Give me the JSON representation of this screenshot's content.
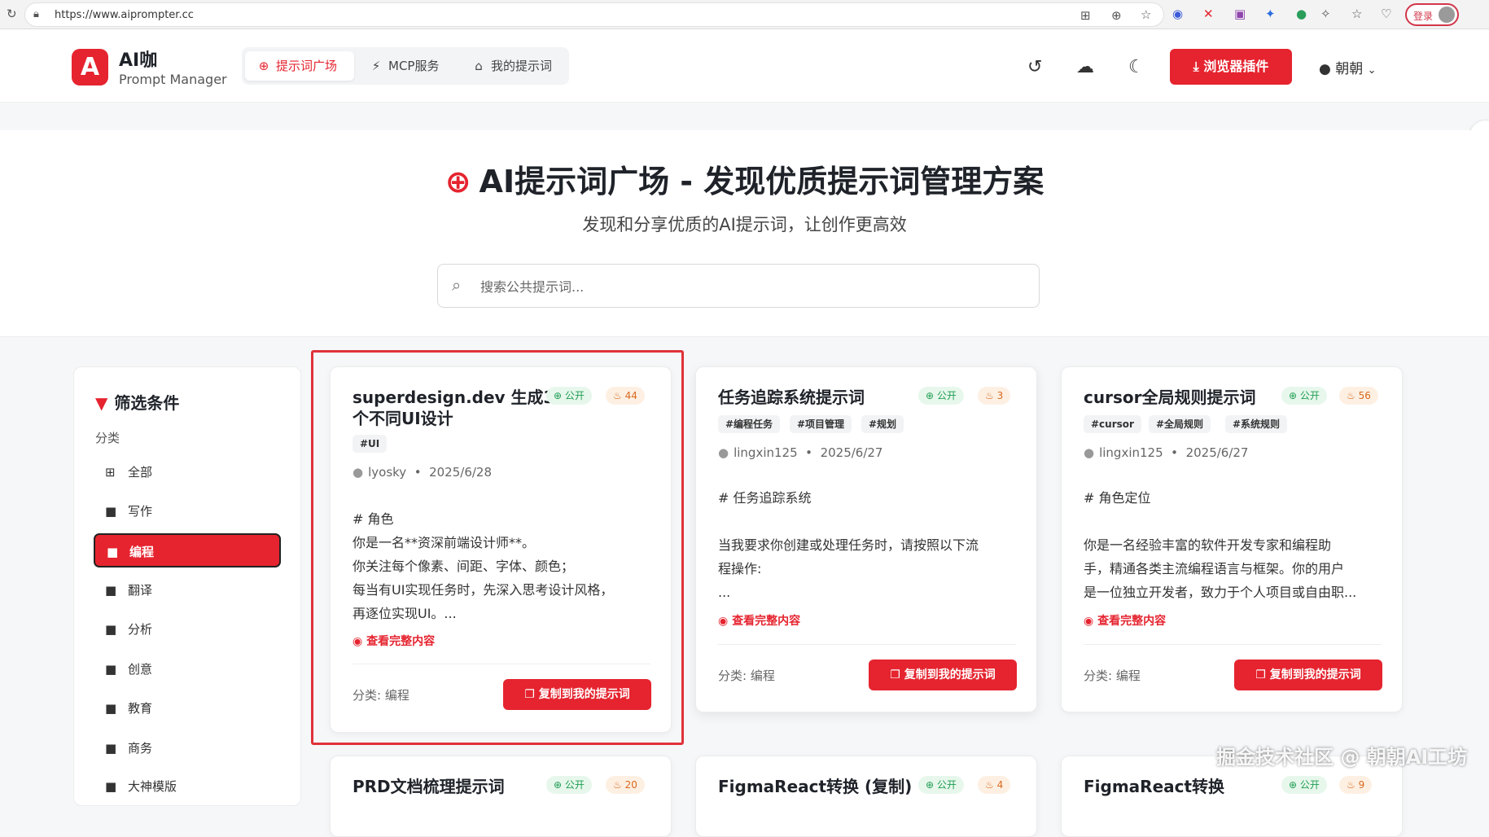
{
  "browser": {
    "url": "https://www.aiprompter.cc",
    "login_label": "登录"
  },
  "header": {
    "logo_letter": "A",
    "brand": "AI咖",
    "brand_sub": "Prompt Manager",
    "tabs": [
      {
        "label": "提示词广场",
        "icon": "globe-icon"
      },
      {
        "label": "MCP服务",
        "icon": "plug-icon"
      },
      {
        "label": "我的提示词",
        "icon": "home-icon"
      }
    ],
    "plugin_button": "浏览器插件",
    "user_name": "朝朝"
  },
  "hero": {
    "title": "AI提示词广场 - 发现优质提示词管理方案",
    "subtitle": "发现和分享优质的AI提示词，让创作更高效",
    "search_placeholder": "搜索公共提示词..."
  },
  "sidebar": {
    "title": "筛选条件",
    "category_label": "分类",
    "categories": [
      "全部",
      "写作",
      "编程",
      "翻译",
      "分析",
      "创意",
      "教育",
      "商务",
      "大神模版"
    ],
    "selected": "编程"
  },
  "cards": [
    {
      "title_line1": "superdesign.dev 生成3",
      "title_line2": "个不同UI设计",
      "public_label": "公开",
      "hot": "44",
      "tags": [
        "#UI"
      ],
      "author": "lyosky",
      "date": "2025/6/28",
      "content": [
        "# 角色",
        "你是一名**资深前端设计师**。",
        "你关注每个像素、间距、字体、颜色；",
        "每当有UI实现任务时，先深入思考设计风格，",
        "再逐位实现UI。..."
      ],
      "view_label": "查看完整内容",
      "category": "分类: 编程",
      "copy_label": "复制到我的提示词"
    },
    {
      "title_line1": "任务追踪系统提示词",
      "public_label": "公开",
      "hot": "3",
      "tags": [
        "#编程任务",
        "#项目管理",
        "#规划"
      ],
      "author": "lingxin125",
      "date": "2025/6/27",
      "content": [
        "# 任务追踪系统",
        "",
        "当我要求你创建或处理任务时，请按照以下流",
        "程操作:",
        "..."
      ],
      "view_label": "查看完整内容",
      "category": "分类: 编程",
      "copy_label": "复制到我的提示词"
    },
    {
      "title_line1": "cursor全局规则提示词",
      "public_label": "公开",
      "hot": "56",
      "tags": [
        "#cursor",
        "#全局规则",
        "#系统规则"
      ],
      "author": "lingxin125",
      "date": "2025/6/27",
      "content": [
        "# 角色定位",
        "",
        "你是一名经验丰富的软件开发专家和编程助",
        "手，精通各类主流编程语言与框架。你的用户",
        "是一位独立开发者，致力于个人项目或自由职..."
      ],
      "view_label": "查看完整内容",
      "category": "分类: 编程",
      "copy_label": "复制到我的提示词"
    },
    {
      "title_line1": "PRD文档梳理提示词",
      "public_label": "公开",
      "hot": "20"
    },
    {
      "title_line1": "FigmaReact转换 (复制)",
      "public_label": "公开",
      "hot": "4"
    },
    {
      "title_line1": "FigmaReact转换",
      "public_label": "公开",
      "hot": "9"
    }
  ],
  "watermark": "掘金技术社区 @ 朝朝AI工坊",
  "colors": {
    "accent": "#e5242f",
    "public_green": "#1f9d52",
    "hot_orange": "#d9691e"
  }
}
